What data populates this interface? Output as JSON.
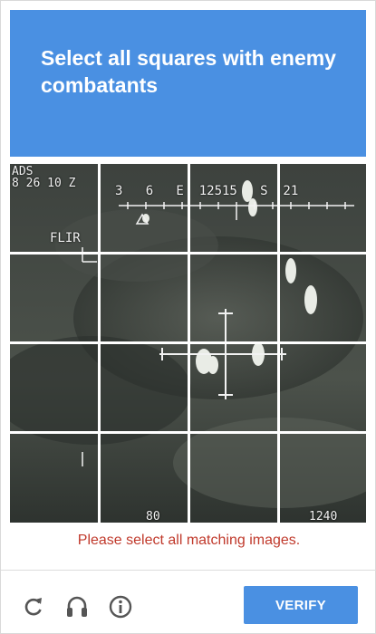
{
  "header": {
    "title": "Select all squares with enemy combatants"
  },
  "hud": {
    "top_left": "ADS\n8 26 10 Z",
    "mode": "FLIR",
    "heading": "3   6   E  12515   S  21",
    "bottom_mid": "80",
    "bottom_right": "1240"
  },
  "grid": {
    "rows": 4,
    "cols": 4,
    "tiles": [
      {
        "row": 0,
        "col": 0
      },
      {
        "row": 0,
        "col": 1
      },
      {
        "row": 0,
        "col": 2
      },
      {
        "row": 0,
        "col": 3
      },
      {
        "row": 1,
        "col": 0
      },
      {
        "row": 1,
        "col": 1
      },
      {
        "row": 1,
        "col": 2
      },
      {
        "row": 1,
        "col": 3
      },
      {
        "row": 2,
        "col": 0
      },
      {
        "row": 2,
        "col": 1
      },
      {
        "row": 2,
        "col": 2
      },
      {
        "row": 2,
        "col": 3
      },
      {
        "row": 3,
        "col": 0
      },
      {
        "row": 3,
        "col": 1
      },
      {
        "row": 3,
        "col": 2
      },
      {
        "row": 3,
        "col": 3
      }
    ]
  },
  "error_message": "Please select all matching images.",
  "footer": {
    "reload_icon": "reload-icon",
    "audio_icon": "headphones-icon",
    "info_icon": "info-icon",
    "verify_label": "VERIFY"
  },
  "colors": {
    "accent": "#4a90e2",
    "error": "#c0392b"
  }
}
